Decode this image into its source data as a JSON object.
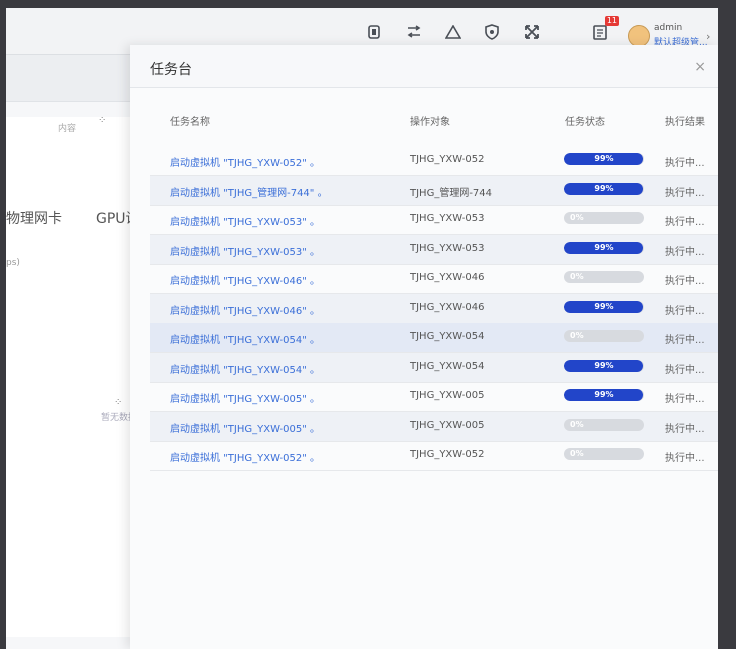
{
  "topbar": {
    "icons": [
      "screen-icon",
      "switch-icon",
      "warning-icon",
      "shield-icon",
      "fullscreen-icon",
      "task-icon"
    ],
    "task_badge": "11",
    "user": {
      "name": "admin",
      "role": "默认超级管..."
    }
  },
  "background": {
    "label": "内容",
    "tab1": "物理网卡",
    "tab2": "GPU设",
    "subtext": "ps)",
    "empty_text": "暂无数据"
  },
  "panel": {
    "title": "任务台",
    "columns": {
      "name": "任务名称",
      "target": "操作对象",
      "status": "任务状态",
      "result": "执行结果"
    },
    "rows": [
      {
        "name": "启动虚拟机 \"TJHG_YXW-052\" 。",
        "target": "TJHG_YXW-052",
        "progress": 99,
        "progress_label": "99%",
        "result": "执行中..."
      },
      {
        "name": "启动虚拟机 \"TJHG_管理网-744\" 。",
        "target": "TJHG_管理网-744",
        "progress": 99,
        "progress_label": "99%",
        "result": "执行中..."
      },
      {
        "name": "启动虚拟机 \"TJHG_YXW-053\" 。",
        "target": "TJHG_YXW-053",
        "progress": 0,
        "progress_label": "0%",
        "result": "执行中..."
      },
      {
        "name": "启动虚拟机 \"TJHG_YXW-053\" 。",
        "target": "TJHG_YXW-053",
        "progress": 99,
        "progress_label": "99%",
        "result": "执行中..."
      },
      {
        "name": "启动虚拟机 \"TJHG_YXW-046\" 。",
        "target": "TJHG_YXW-046",
        "progress": 0,
        "progress_label": "0%",
        "result": "执行中..."
      },
      {
        "name": "启动虚拟机 \"TJHG_YXW-046\" 。",
        "target": "TJHG_YXW-046",
        "progress": 99,
        "progress_label": "99%",
        "result": "执行中..."
      },
      {
        "name": "启动虚拟机 \"TJHG_YXW-054\" 。",
        "target": "TJHG_YXW-054",
        "progress": 0,
        "progress_label": "0%",
        "result": "执行中..."
      },
      {
        "name": "启动虚拟机 \"TJHG_YXW-054\" 。",
        "target": "TJHG_YXW-054",
        "progress": 99,
        "progress_label": "99%",
        "result": "执行中..."
      },
      {
        "name": "启动虚拟机 \"TJHG_YXW-005\" 。",
        "target": "TJHG_YXW-005",
        "progress": 99,
        "progress_label": "99%",
        "result": "执行中..."
      },
      {
        "name": "启动虚拟机 \"TJHG_YXW-005\" 。",
        "target": "TJHG_YXW-005",
        "progress": 0,
        "progress_label": "0%",
        "result": "执行中..."
      },
      {
        "name": "启动虚拟机 \"TJHG_YXW-052\" 。",
        "target": "TJHG_YXW-052",
        "progress": 0,
        "progress_label": "0%",
        "result": "执行中..."
      }
    ]
  },
  "colors": {
    "accent": "#2245c9",
    "link": "#3b6fd8",
    "badge": "#e53935"
  }
}
